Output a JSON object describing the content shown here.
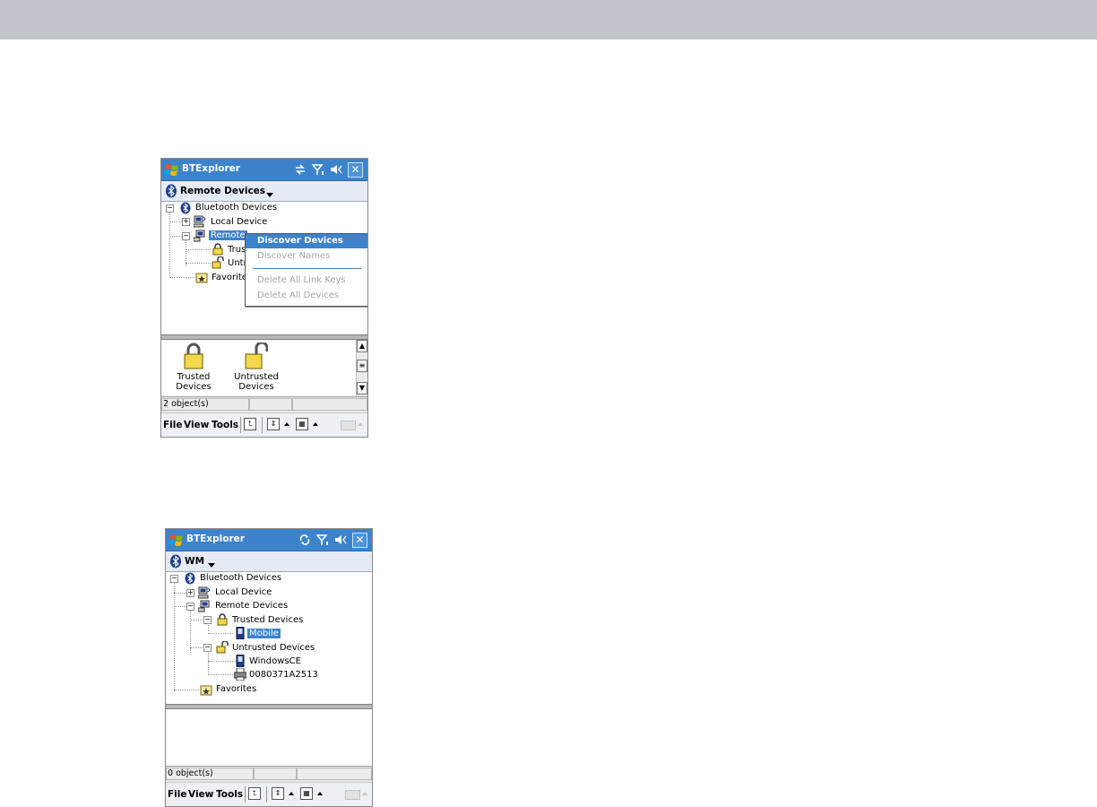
{
  "screen1": {
    "title": "BTExplorer",
    "nav_label": "Remote Devices",
    "tree": {
      "root": "Bluetooth Devices",
      "local": "Local Device",
      "remote_partial": "Remote",
      "trusted_partial": "Trus",
      "untrusted_partial": "Untr",
      "favorites_partial": "Favorite"
    },
    "context_menu": {
      "discover_devices": "Discover Devices",
      "discover_names": "Discover Names",
      "delete_link_keys": "Delete All Link Keys",
      "delete_all_devices": "Delete All Devices"
    },
    "list": [
      {
        "line1": "Trusted",
        "line2": "Devices"
      },
      {
        "line1": "Untrusted",
        "line2": "Devices"
      }
    ],
    "status": "2 object(s)",
    "menu": {
      "file": "File",
      "view": "View",
      "tools": "Tools"
    }
  },
  "screen2": {
    "title": "BTExplorer",
    "nav_label": "WM",
    "tree": {
      "root": "Bluetooth Devices",
      "local": "Local Device",
      "remote": "Remote Devices",
      "trusted": "Trusted Devices",
      "mobile": "Mobile",
      "untrusted": "Untrusted Devices",
      "windowsce": "WindowsCE",
      "address": "0080371A2513",
      "favorites": "Favorites"
    },
    "status": "0 object(s)",
    "menu": {
      "file": "File",
      "view": "View",
      "tools": "Tools"
    }
  },
  "icons": {
    "start": "windows-flag-icon",
    "connectivity": "connectivity-arrows-icon",
    "signal": "signal-strength-icon",
    "volume": "speaker-icon",
    "close": "close-icon",
    "bluetooth": "bluetooth-icon",
    "computer": "computer-icon",
    "lock": "padlock-icon",
    "unlock": "open-padlock-icon",
    "favorites": "star-folder-icon",
    "phone": "mobile-phone-icon",
    "printer": "printer-icon"
  },
  "colors": {
    "title_bar": "#3d83cc",
    "selection": "#3d83cc",
    "header_bar": "#c2c4cb"
  }
}
